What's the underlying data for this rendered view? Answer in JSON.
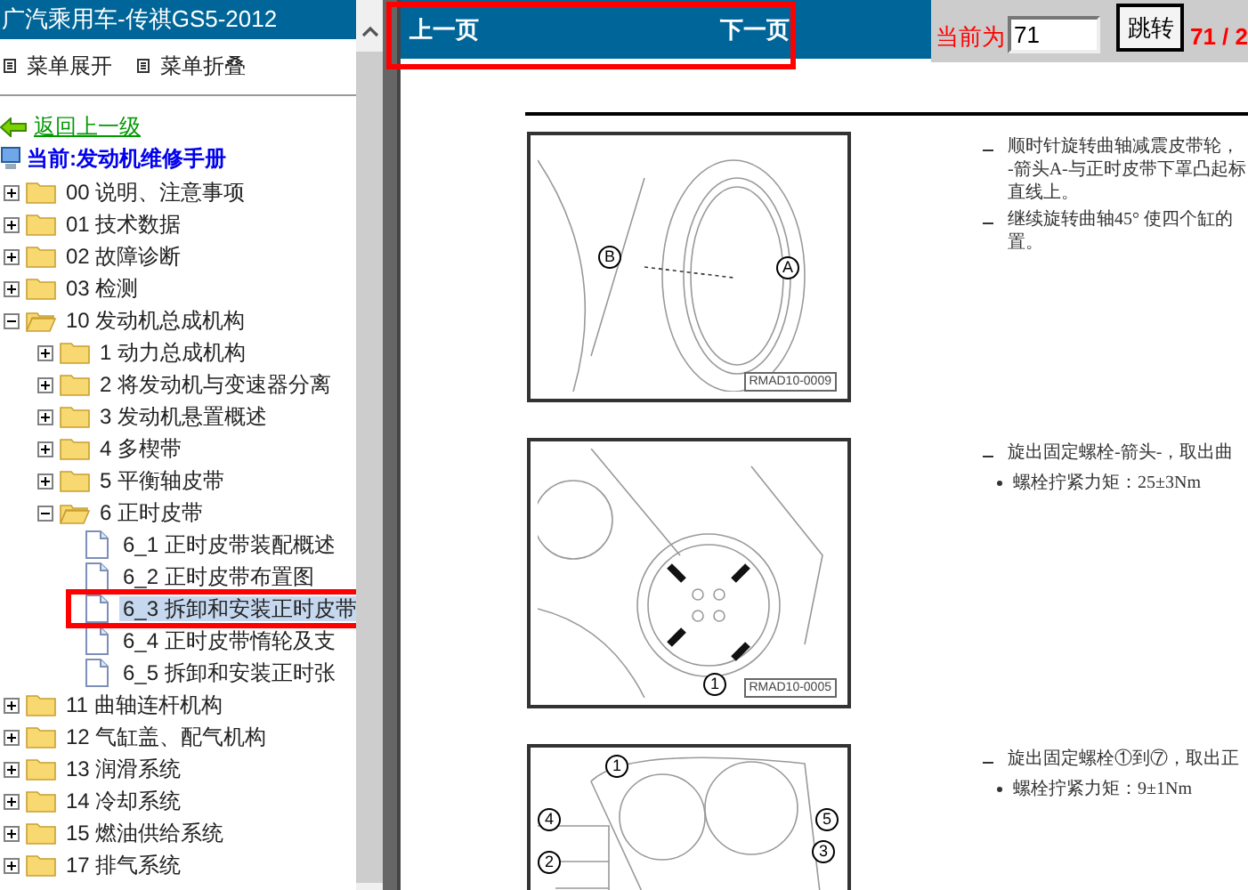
{
  "sidebar": {
    "title": "广汽乘用车-传祺GS5-2012",
    "menu_actions": [
      "菜单展开",
      "菜单折叠"
    ],
    "back_link": "返回上一级",
    "current": "当前:发动机维修手册",
    "tree": [
      {
        "kind": "folder",
        "label": "00 说明、注意事项",
        "expanded": false,
        "selected": false
      },
      {
        "kind": "folder",
        "label": "01 技术数据",
        "expanded": false,
        "selected": false
      },
      {
        "kind": "folder",
        "label": "02 故障诊断",
        "expanded": false,
        "selected": false
      },
      {
        "kind": "folder",
        "label": "03 检测",
        "expanded": false,
        "selected": false
      },
      {
        "kind": "folder",
        "label": "10 发动机总成机构",
        "expanded": true,
        "selected": false,
        "children": [
          {
            "kind": "folder",
            "label": "1 动力总成机构",
            "expanded": false,
            "selected": false
          },
          {
            "kind": "folder",
            "label": "2 将发动机与变速器分离",
            "expanded": false,
            "selected": false
          },
          {
            "kind": "folder",
            "label": "3 发动机悬置概述",
            "expanded": false,
            "selected": false
          },
          {
            "kind": "folder",
            "label": "4 多楔带",
            "expanded": false,
            "selected": false
          },
          {
            "kind": "folder",
            "label": "5 平衡轴皮带",
            "expanded": false,
            "selected": false
          },
          {
            "kind": "folder",
            "label": "6 正时皮带",
            "expanded": true,
            "selected": false,
            "children": [
              {
                "kind": "page",
                "label": "6_1 正时皮带装配概述",
                "selected": false
              },
              {
                "kind": "page",
                "label": "6_2 正时皮带布置图",
                "selected": false
              },
              {
                "kind": "page",
                "label": "6_3 拆卸和安装正时皮带",
                "selected": true
              },
              {
                "kind": "page",
                "label": "6_4 正时皮带惰轮及支",
                "selected": false
              },
              {
                "kind": "page",
                "label": "6_5 拆卸和安装正时张",
                "selected": false
              }
            ]
          }
        ]
      },
      {
        "kind": "folder",
        "label": "11 曲轴连杆机构",
        "expanded": false,
        "selected": false
      },
      {
        "kind": "folder",
        "label": "12 气缸盖、配气机构",
        "expanded": false,
        "selected": false
      },
      {
        "kind": "folder",
        "label": "13 润滑系统",
        "expanded": false,
        "selected": false
      },
      {
        "kind": "folder",
        "label": "14 冷却系统",
        "expanded": false,
        "selected": false
      },
      {
        "kind": "folder",
        "label": "15 燃油供给系统",
        "expanded": false,
        "selected": false
      },
      {
        "kind": "folder",
        "label": "17 排气系统",
        "expanded": false,
        "selected": false
      }
    ]
  },
  "toolbar": {
    "prev": "上一页",
    "next": "下一页",
    "current_label": "当前为",
    "page_input": "71",
    "jump_button": "跳转",
    "page_count": "71 / 2"
  },
  "document": {
    "steps": [
      {
        "figure": {
          "code": "RMAD10-0009",
          "callouts": [
            "B",
            "A"
          ]
        },
        "lines": [
          {
            "kind": "dash",
            "text": "顺时针旋转曲轴减震皮带轮，"
          },
          {
            "kind": "cont",
            "text": "-箭头A-与正时皮带下罩凸起标"
          },
          {
            "kind": "cont",
            "text": "直线上。"
          },
          {
            "kind": "dash",
            "text": "继续旋转曲轴45° 使四个缸的"
          },
          {
            "kind": "cont",
            "text": "置。"
          }
        ]
      },
      {
        "figure": {
          "code": "RMAD10-0005",
          "callouts": [
            "1"
          ]
        },
        "lines": [
          {
            "kind": "dash",
            "text": "旋出固定螺栓-箭头-，取出曲"
          },
          {
            "kind": "bullet",
            "text": "螺栓拧紧力矩：25±3Nm"
          }
        ]
      },
      {
        "figure": {
          "callouts": [
            "1",
            "4",
            "5",
            "2",
            "3"
          ]
        },
        "lines": [
          {
            "kind": "dash",
            "text": "旋出固定螺栓①到⑦，取出正"
          },
          {
            "kind": "bullet",
            "text": "螺栓拧紧力矩：9±1Nm"
          }
        ]
      }
    ]
  }
}
